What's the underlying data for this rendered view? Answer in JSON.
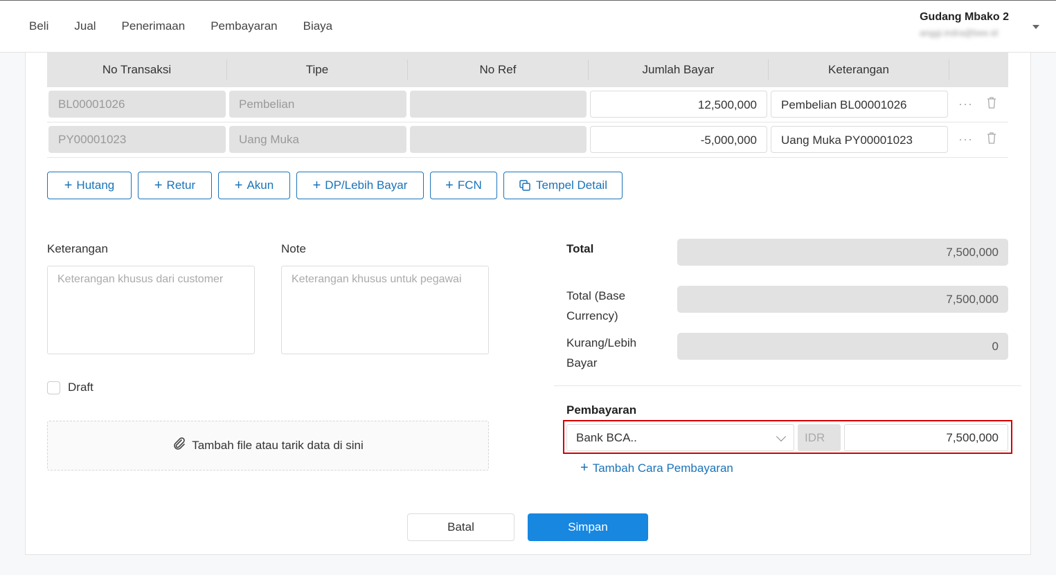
{
  "nav": [
    "Beli",
    "Jual",
    "Penerimaan",
    "Pembayaran",
    "Biaya"
  ],
  "user": {
    "company": "Gudang Mbako 2",
    "email": "anggi.indra@bee.id"
  },
  "table": {
    "headers": [
      "No Transaksi",
      "Tipe",
      "No Ref",
      "Jumlah Bayar",
      "Keterangan"
    ],
    "rows": [
      {
        "no_transaksi": "BL00001026",
        "tipe": "Pembelian",
        "no_ref": "",
        "jumlah": "12,500,000",
        "keterangan": "Pembelian BL00001026"
      },
      {
        "no_transaksi": "PY00001023",
        "tipe": "Uang Muka",
        "no_ref": "",
        "jumlah": "-5,000,000",
        "keterangan": "Uang Muka PY00001023"
      }
    ],
    "row_menu_glyph": "···"
  },
  "add_buttons": [
    "Hutang",
    "Retur",
    "Akun",
    "DP/Lebih Bayar",
    "FCN"
  ],
  "paste_button": "Tempel Detail",
  "keterangan": {
    "label": "Keterangan",
    "placeholder": "Keterangan khusus dari customer"
  },
  "note": {
    "label": "Note",
    "placeholder": "Keterangan khusus untuk pegawai"
  },
  "draft_label": "Draft",
  "dropzone_label": "Tambah file atau tarik data di sini",
  "summary": {
    "total_label": "Total",
    "total_value": "7,500,000",
    "base_label_1": "Total (Base",
    "base_label_2": "Currency)",
    "base_value": "7,500,000",
    "diff_label_1": "Kurang/Lebih",
    "diff_label_2": "Bayar",
    "diff_value": "0"
  },
  "payment": {
    "label": "Pembayaran",
    "method": "Bank BCA..",
    "currency": "IDR",
    "amount": "7,500,000",
    "add_label": "Tambah Cara Pembayaran"
  },
  "actions": {
    "cancel": "Batal",
    "save": "Simpan"
  },
  "colors": {
    "accent": "#1a73b8",
    "primary_button": "#1787e0",
    "highlight": "#d40000"
  }
}
